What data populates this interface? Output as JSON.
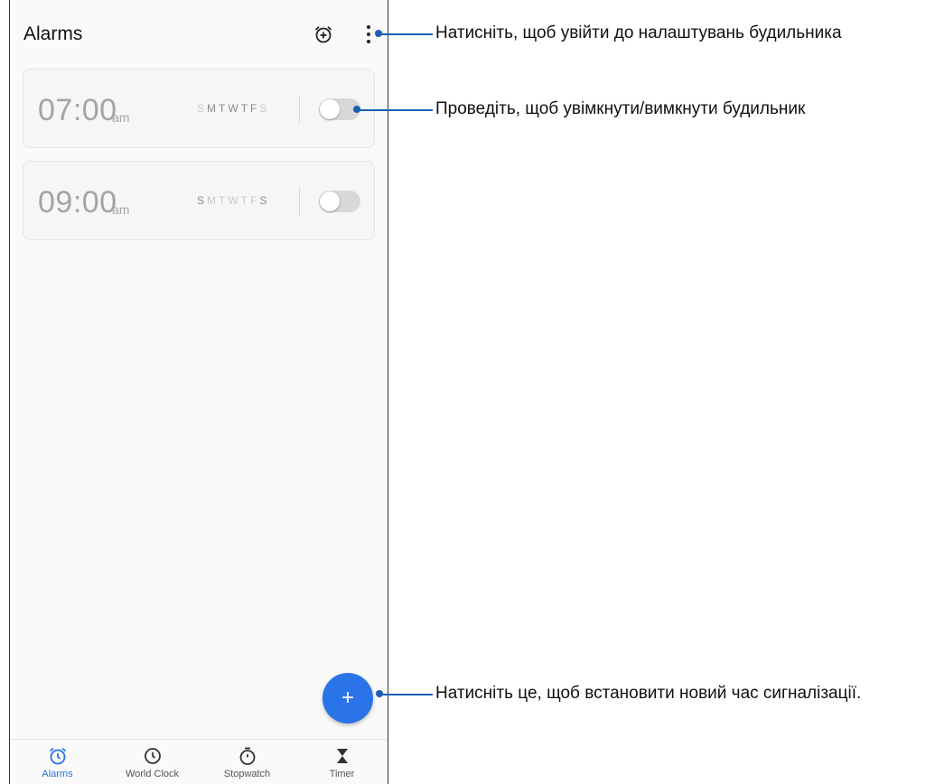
{
  "app": {
    "title": "Alarms"
  },
  "alarms": [
    {
      "time": "07:00",
      "ampm": "am",
      "days": [
        "S",
        "M",
        "T",
        "W",
        "T",
        "F",
        "S"
      ],
      "active_days": [
        1,
        2,
        3,
        4,
        5
      ],
      "enabled": false
    },
    {
      "time": "09:00",
      "ampm": "am",
      "days": [
        "S",
        "M",
        "T",
        "W",
        "T",
        "F",
        "S"
      ],
      "active_days": [
        0,
        6
      ],
      "enabled": false
    }
  ],
  "fab": {
    "label": "+"
  },
  "tabs": [
    {
      "label": "Alarms",
      "icon": "alarm-clock-icon",
      "active": true
    },
    {
      "label": "World Clock",
      "icon": "clock-icon",
      "active": false
    },
    {
      "label": "Stopwatch",
      "icon": "stopwatch-icon",
      "active": false
    },
    {
      "label": "Timer",
      "icon": "hourglass-icon",
      "active": false
    }
  ],
  "callouts": {
    "settings": "Натисніть, щоб увійти до налаштувань будильника",
    "toggle": "Проведіть, щоб увімкнути/вимкнути будильник",
    "add": "Натисніть це, щоб встановити новий час сигналізації."
  },
  "colors": {
    "accent": "#2b73e8",
    "callout": "#1a5fb4",
    "inactive_text": "#a4a4a4"
  }
}
